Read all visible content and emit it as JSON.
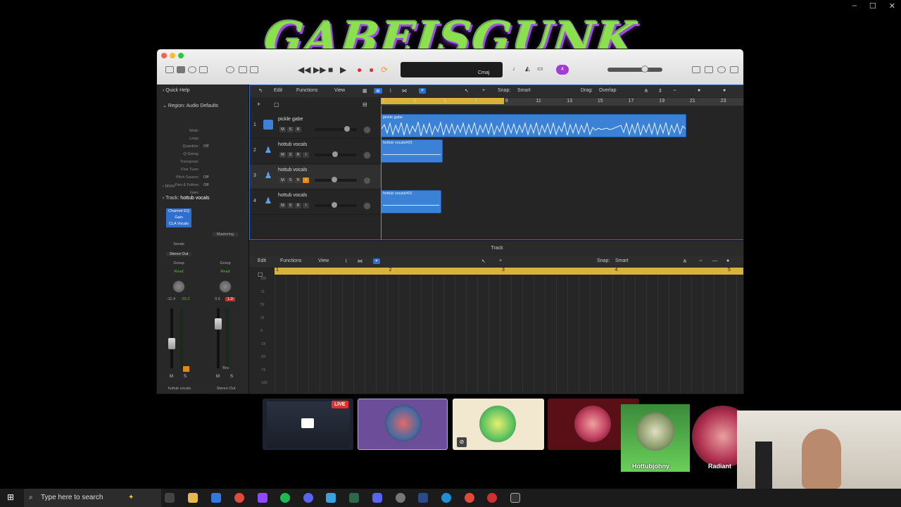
{
  "window_controls": {
    "minimize": "‒",
    "maximize": "☐",
    "close": "✕"
  },
  "banner": {
    "text": "GABEISGUNK"
  },
  "daw": {
    "lcd": {
      "key": "Cmaj"
    },
    "count_badge": "4"
  },
  "inspector": {
    "quick_help": "Quick Help",
    "region_label": "Region:",
    "region_value": "Audio Defaults",
    "params": [
      {
        "label": "Mute:",
        "value": ""
      },
      {
        "label": "Loop:",
        "value": ""
      },
      {
        "label": "Quantize:",
        "value": "Off"
      },
      {
        "label": "Q-Swing:",
        "value": ""
      },
      {
        "label": "Transpose:",
        "value": ""
      },
      {
        "label": "Fine Tune:",
        "value": ""
      },
      {
        "label": "Pitch Source:",
        "value": "Off"
      },
      {
        "label": "Flex & Follow:",
        "value": "Off"
      },
      {
        "label": "Gain:",
        "value": ""
      }
    ],
    "more": "More",
    "track_label": "Track:",
    "track_value": "hottub vocals",
    "plugins": [
      "Channel EQ",
      "Gain",
      "CLA Vocals"
    ],
    "mastering": "Mastering",
    "sends": "Sends",
    "stereo_out": "Stereo Out",
    "group": "Group",
    "read": "Read",
    "strip1": {
      "val_a": "-11.4",
      "val_b": "-29.3",
      "mute": "M",
      "solo": "S",
      "name": "hottub vocals"
    },
    "strip2": {
      "val_a": "0.0",
      "val_b": "1.0",
      "bnc": "Bnc",
      "mute": "M",
      "solo": "S",
      "name": "Stereo Out"
    }
  },
  "tracks_toolbar": {
    "edit": "Edit",
    "functions": "Functions",
    "view": "View",
    "snap_label": "Snap:",
    "snap_value": "Smart",
    "drag_label": "Drag:",
    "drag_value": "Overlap"
  },
  "ruler": [
    "1",
    "3",
    "5",
    "7",
    "9",
    "11",
    "13",
    "15",
    "17",
    "19",
    "21",
    "23"
  ],
  "tracks": [
    {
      "num": "1",
      "name": "pickle gabe",
      "msr": [
        "M",
        "S",
        "R"
      ],
      "volume": 0.75
    },
    {
      "num": "2",
      "name": "hottub vocals",
      "msr": [
        "M",
        "S",
        "R",
        "I"
      ],
      "volume": 0.45
    },
    {
      "num": "3",
      "name": "hottub vocals",
      "msr": [
        "M",
        "S",
        "R",
        "I"
      ],
      "volume": 0.43
    },
    {
      "num": "4",
      "name": "hottub vocals",
      "msr": [
        "M",
        "S",
        "R",
        "I"
      ],
      "volume": 0.43
    }
  ],
  "regions": [
    {
      "label": "pickle gabe"
    },
    {
      "label": "hottub vocals#03"
    },
    {
      "label": "hottub vocals#01"
    }
  ],
  "editor": {
    "title": "Track",
    "edit": "Edit",
    "functions": "Functions",
    "view": "View",
    "snap_label": "Snap:",
    "snap_value": "Smart",
    "ruler": [
      "1",
      "2",
      "3",
      "4",
      "5"
    ],
    "y_labels": [
      "100",
      "75",
      "50",
      "25",
      "0",
      "-25",
      "-50",
      "-75",
      "-100"
    ]
  },
  "participants": {
    "live_badge": "LIVE",
    "names": [
      "Hottubjohny",
      "Radiant"
    ]
  },
  "taskbar": {
    "search_placeholder": "Type here to search"
  },
  "colors": {
    "region_blue": "#3b82d6",
    "cycle_yellow": "#d9b23b",
    "select_blue": "#2f6fd0",
    "live_red": "#e0312c",
    "badge_purple": "#a33bd6"
  }
}
